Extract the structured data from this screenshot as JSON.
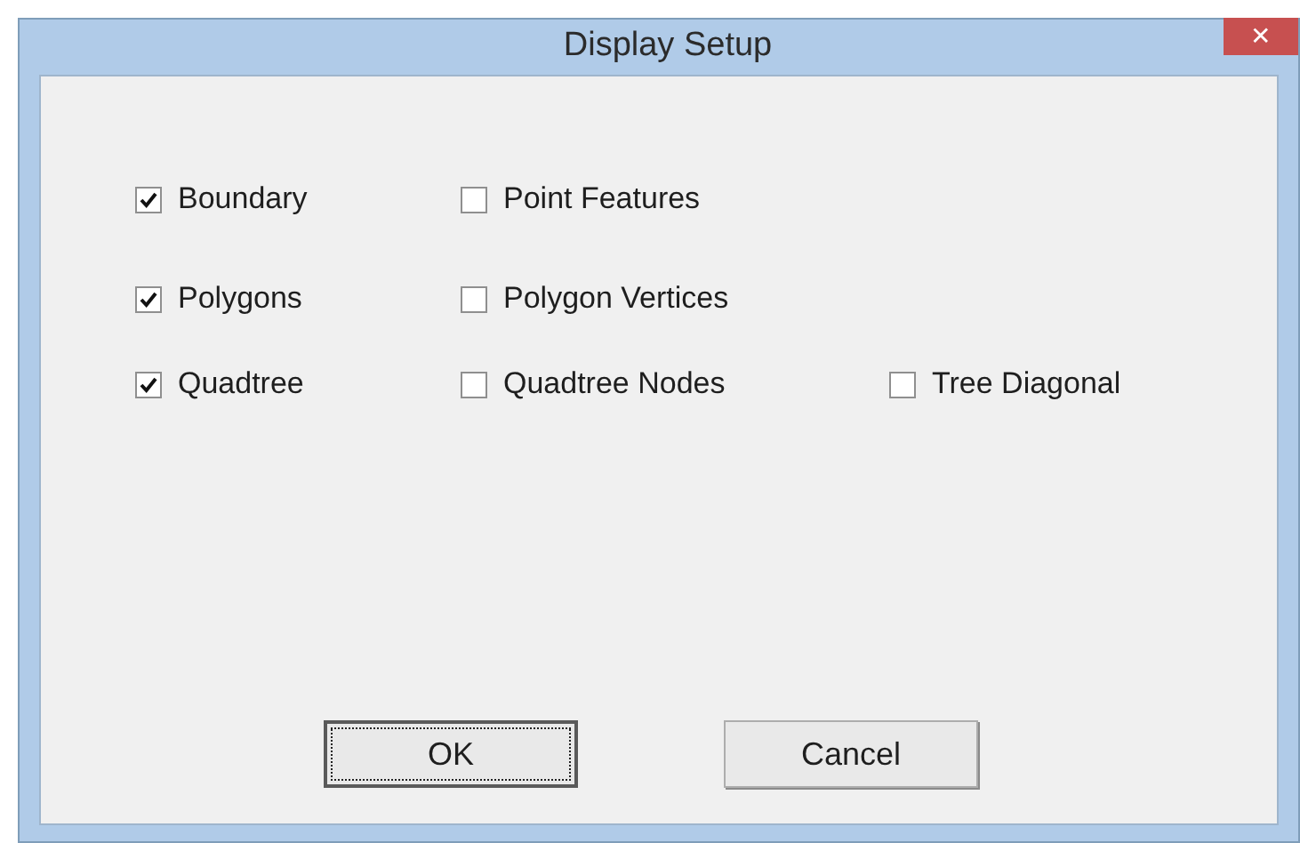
{
  "window": {
    "title": "Display Setup",
    "close": "✕"
  },
  "checkbox_rows": [
    [
      {
        "label": "Boundary",
        "checked": true
      },
      {
        "label": "Point Features",
        "checked": false
      }
    ],
    [
      {
        "label": "Polygons",
        "checked": true
      },
      {
        "label": "Polygon Vertices",
        "checked": false
      }
    ],
    [
      {
        "label": "Quadtree",
        "checked": true
      },
      {
        "label": "Quadtree Nodes",
        "checked": false
      },
      {
        "label": "Tree Diagonal",
        "checked": false
      }
    ]
  ],
  "buttons": [
    {
      "label": "OK",
      "focused": true
    },
    {
      "label": "Cancel",
      "focused": false
    }
  ]
}
